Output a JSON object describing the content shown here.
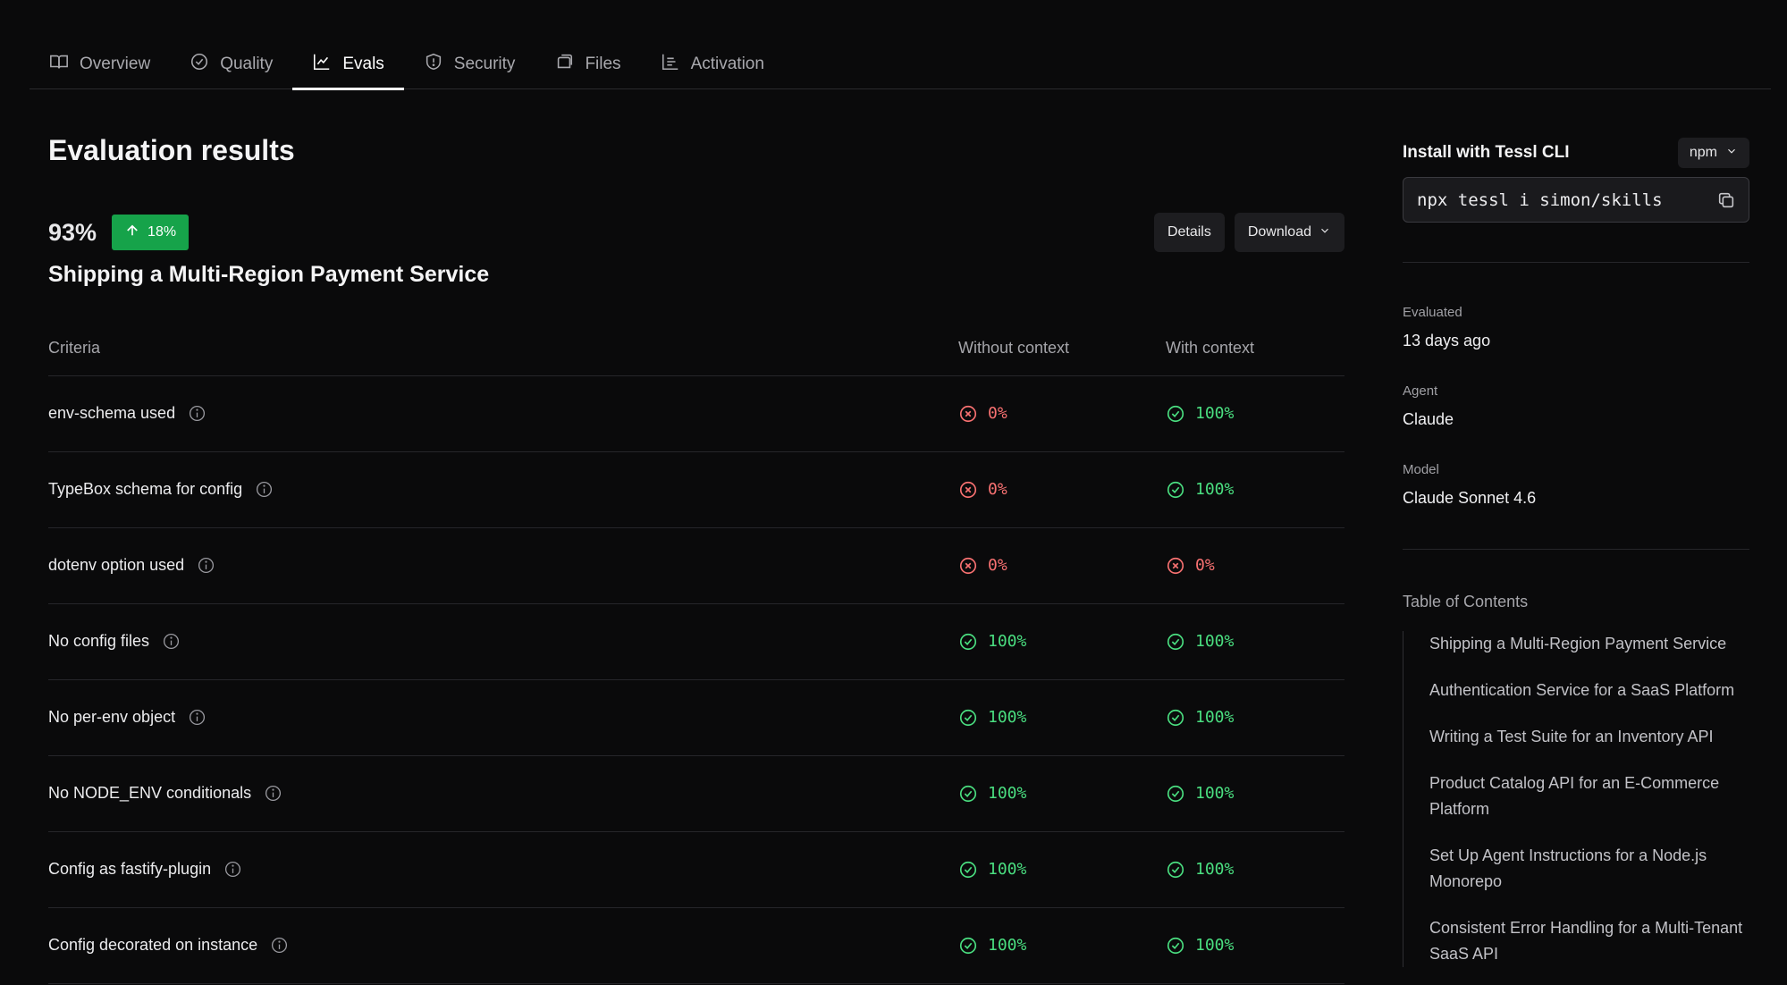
{
  "tabs": [
    {
      "label": "Overview",
      "icon": "book-icon"
    },
    {
      "label": "Quality",
      "icon": "check-circle-icon"
    },
    {
      "label": "Evals",
      "icon": "line-chart-icon",
      "active": true
    },
    {
      "label": "Security",
      "icon": "shield-icon"
    },
    {
      "label": "Files",
      "icon": "files-icon"
    },
    {
      "label": "Activation",
      "icon": "bar-chart-icon"
    }
  ],
  "main": {
    "title": "Evaluation results",
    "score": "93%",
    "delta": "18%",
    "details_label": "Details",
    "download_label": "Download",
    "scenario_title": "Shipping a Multi-Region Payment Service",
    "columns": {
      "criteria": "Criteria",
      "without": "Without context",
      "with": "With context"
    },
    "rows": [
      {
        "criteria": "env-schema used",
        "without": "0%",
        "with": "100%"
      },
      {
        "criteria": "TypeBox schema for config",
        "without": "0%",
        "with": "100%"
      },
      {
        "criteria": "dotenv option used",
        "without": "0%",
        "with": "0%"
      },
      {
        "criteria": "No config files",
        "without": "100%",
        "with": "100%"
      },
      {
        "criteria": "No per-env object",
        "without": "100%",
        "with": "100%"
      },
      {
        "criteria": "No NODE_ENV conditionals",
        "without": "100%",
        "with": "100%"
      },
      {
        "criteria": "Config as fastify-plugin",
        "without": "100%",
        "with": "100%"
      },
      {
        "criteria": "Config decorated on instance",
        "without": "100%",
        "with": "100%"
      }
    ]
  },
  "sidebar": {
    "install_title": "Install with Tessl CLI",
    "package_manager": "npm",
    "command": "npx tessl i simon/skills",
    "evaluated_label": "Evaluated",
    "evaluated_value": "13 days ago",
    "agent_label": "Agent",
    "agent_value": "Claude",
    "model_label": "Model",
    "model_value": "Claude Sonnet 4.6",
    "toc_title": "Table of Contents",
    "toc": [
      "Shipping a Multi-Region Payment Service",
      "Authentication Service for a SaaS Platform",
      "Writing a Test Suite for an Inventory API",
      "Product Catalog API for an E-Commerce Platform",
      "Set Up Agent Instructions for a Node.js Monorepo",
      "Consistent Error Handling for a Multi-Tenant SaaS API"
    ]
  },
  "colors": {
    "pass": "#4ade80",
    "fail": "#f87171",
    "delta_bg": "#16a34a",
    "background": "#0a0a0b"
  }
}
